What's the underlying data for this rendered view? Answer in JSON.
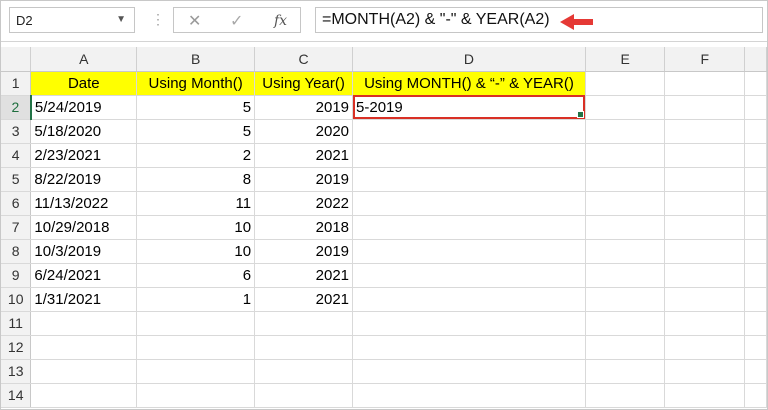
{
  "name_box": {
    "value": "D2"
  },
  "formula_bar": {
    "formula": "=MONTH(A2) & \"-\" & YEAR(A2)",
    "cancel_icon": "close-icon",
    "enter_icon": "check-icon",
    "fx_label": "fx",
    "arrow_color": "#e53935"
  },
  "columns": [
    "A",
    "B",
    "C",
    "D",
    "E",
    "F"
  ],
  "row_numbers": [
    "1",
    "2",
    "3",
    "4",
    "5",
    "6",
    "7",
    "8",
    "9",
    "10",
    "11",
    "12",
    "13",
    "14"
  ],
  "header_row": {
    "date": "Date",
    "month": "Using Month()",
    "year": "Using Year()",
    "combined": "Using MONTH() & “-” & YEAR()"
  },
  "rows": [
    {
      "date": "5/24/2019",
      "month": "5",
      "year": "2019",
      "combined": "5-2019"
    },
    {
      "date": "5/18/2020",
      "month": "5",
      "year": "2020",
      "combined": ""
    },
    {
      "date": "2/23/2021",
      "month": "2",
      "year": "2021",
      "combined": ""
    },
    {
      "date": "8/22/2019",
      "month": "8",
      "year": "2019",
      "combined": ""
    },
    {
      "date": "11/13/2022",
      "month": "11",
      "year": "2022",
      "combined": ""
    },
    {
      "date": "10/29/2018",
      "month": "10",
      "year": "2018",
      "combined": ""
    },
    {
      "date": "10/3/2019",
      "month": "10",
      "year": "2019",
      "combined": ""
    },
    {
      "date": "6/24/2021",
      "month": "6",
      "year": "2021",
      "combined": ""
    },
    {
      "date": "1/31/2021",
      "month": "1",
      "year": "2021",
      "combined": ""
    }
  ],
  "selected_cell": "D2",
  "colors": {
    "header_fill": "#ffff00",
    "selection_border": "#d93025",
    "active_accent": "#217346"
  }
}
